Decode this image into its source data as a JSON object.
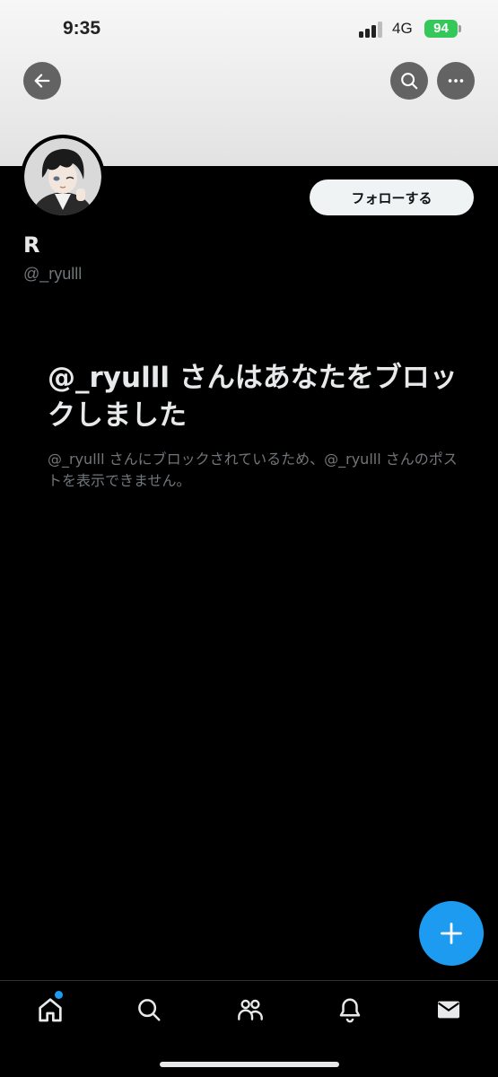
{
  "status_bar": {
    "time": "9:35",
    "network": "4G",
    "battery": "94"
  },
  "header": {
    "back_icon": "arrow-left-icon",
    "search_icon": "search-icon",
    "more_icon": "more-horizontal-icon",
    "banner_color": "#ececec"
  },
  "profile": {
    "display_name": "R",
    "handle": "@_ryulll",
    "follow_label": "フォローする"
  },
  "blocked": {
    "title": "@_ryulll さんはあなたをブロックしました",
    "description": "@_ryulll さんにブロックされているため、@_ryulll さんのポストを表示できません。"
  },
  "fab": {
    "icon": "plus-icon",
    "color": "#1d9bf0"
  },
  "tab_bar": {
    "items": [
      {
        "name": "home",
        "icon": "home-icon",
        "has_badge": true
      },
      {
        "name": "search",
        "icon": "search-icon"
      },
      {
        "name": "communities",
        "icon": "people-icon"
      },
      {
        "name": "notifications",
        "icon": "bell-icon"
      },
      {
        "name": "messages",
        "icon": "envelope-icon"
      }
    ]
  },
  "colors": {
    "background": "#000000",
    "accent": "#1d9bf0",
    "secondary_text": "#71767b"
  }
}
